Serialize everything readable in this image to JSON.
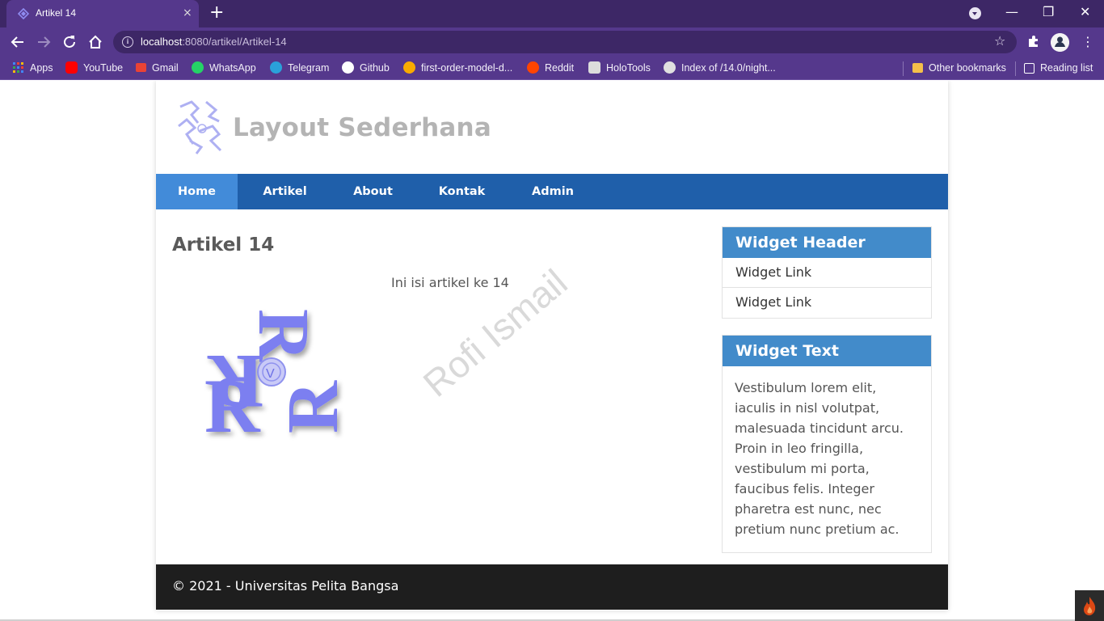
{
  "browser": {
    "tab": {
      "title": "Artikel 14",
      "close_icon": "×"
    },
    "new_tab_icon": "+",
    "window_controls": {
      "minimize": "—",
      "restore": "❐",
      "close": "✕"
    },
    "omnibox": {
      "host": "localhost",
      "rest": ":8080/artikel/Artikel-14",
      "info_icon": "i",
      "star_icon": "☆"
    },
    "menu_icon": "⋮",
    "bookmarks": [
      {
        "label": "Apps",
        "icon": "apps-grid-icon",
        "color": "#4285f4"
      },
      {
        "label": "YouTube",
        "icon": "youtube-icon",
        "color": "#ff0000"
      },
      {
        "label": "Gmail",
        "icon": "gmail-icon",
        "color": "#ea4335"
      },
      {
        "label": "WhatsApp",
        "icon": "whatsapp-icon",
        "color": "#25d366"
      },
      {
        "label": "Telegram",
        "icon": "telegram-icon",
        "color": "#2aa1da"
      },
      {
        "label": "Github",
        "icon": "github-icon",
        "color": "#ffffff"
      },
      {
        "label": "first-order-model-d...",
        "icon": "colab-icon",
        "color": "#f9ab00"
      },
      {
        "label": "Reddit",
        "icon": "reddit-icon",
        "color": "#ff4500"
      },
      {
        "label": "HoloTools",
        "icon": "holotools-icon",
        "color": "#dcdcdc"
      },
      {
        "label": "Index of /14.0/night...",
        "icon": "globe-icon",
        "color": "#e0e0e0"
      },
      {
        "label": "Other bookmarks",
        "icon": "folder-icon",
        "color": "#f5c04a"
      },
      {
        "label": "Reading list",
        "icon": "reading-list-icon",
        "color": "#ffffff"
      }
    ]
  },
  "site": {
    "title": "Layout Sederhana",
    "nav": [
      {
        "label": "Home",
        "active": true
      },
      {
        "label": "Artikel",
        "active": false
      },
      {
        "label": "About",
        "active": false
      },
      {
        "label": "Kontak",
        "active": false
      },
      {
        "label": "Admin",
        "active": false
      }
    ],
    "article": {
      "title": "Artikel 14",
      "body": "Ini isi artikel ke 14",
      "watermark": "Rofi Ismail"
    },
    "widgets": [
      {
        "header": "Widget Header",
        "links": [
          "Widget Link",
          "Widget Link"
        ]
      },
      {
        "header": "Widget Text",
        "text": "Vestibulum lorem elit, iaculis in nisl volutpat, malesuada tincidunt arcu. Proin in leo fringilla, vestibulum mi porta, faucibus felis. Integer pharetra est nunc, nec pretium nunc pretium ac."
      }
    ],
    "footer": "© 2021 - Universitas Pelita Bangsa"
  },
  "colors": {
    "chrome_dark": "#3d2766",
    "chrome_light": "#55388c",
    "nav_bg": "#1f5faa",
    "nav_active": "#428bd9",
    "widget_head": "#428bca",
    "footer_bg": "#1e1e1e",
    "logo": "#7b7ff0"
  }
}
